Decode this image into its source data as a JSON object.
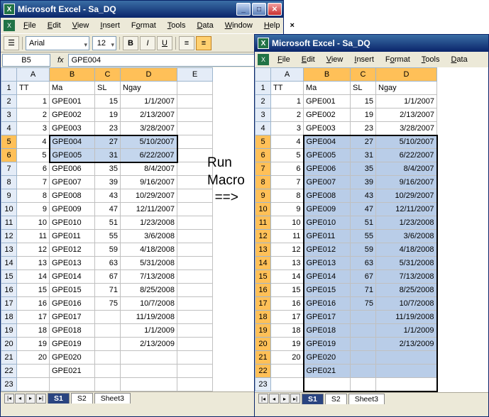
{
  "app_title": "Microsoft Excel - Sa_DQ",
  "menu": [
    "File",
    "Edit",
    "View",
    "Insert",
    "Format",
    "Tools",
    "Data",
    "Window",
    "Help"
  ],
  "menu_short": [
    "File",
    "Edit",
    "View",
    "Insert",
    "Format",
    "Tools",
    "Data"
  ],
  "toolbar": {
    "font": "Arial",
    "size": "12",
    "bold": "B",
    "italic": "I",
    "underline": "U"
  },
  "namebox": "B5",
  "formula": "GPE004",
  "macro_label1": "Run",
  "macro_label2": "Macro",
  "macro_label3": "==>",
  "headers": {
    "A": "A",
    "B": "B",
    "C": "C",
    "D": "D",
    "E": "E"
  },
  "row1": {
    "A": "TT",
    "B": "Ma",
    "C": "SL",
    "D": "Ngay"
  },
  "rows": [
    {
      "n": "1",
      "A": "1",
      "B": "GPE001",
      "C": "15",
      "D": "1/1/2007"
    },
    {
      "n": "2",
      "A": "2",
      "B": "GPE002",
      "C": "19",
      "D": "2/13/2007"
    },
    {
      "n": "3",
      "A": "3",
      "B": "GPE003",
      "C": "23",
      "D": "3/28/2007"
    },
    {
      "n": "4",
      "A": "4",
      "B": "GPE004",
      "C": "27",
      "D": "5/10/2007"
    },
    {
      "n": "5",
      "A": "5",
      "B": "GPE005",
      "C": "31",
      "D": "6/22/2007"
    },
    {
      "n": "6",
      "A": "6",
      "B": "GPE006",
      "C": "35",
      "D": "8/4/2007"
    },
    {
      "n": "7",
      "A": "7",
      "B": "GPE007",
      "C": "39",
      "D": "9/16/2007"
    },
    {
      "n": "8",
      "A": "8",
      "B": "GPE008",
      "C": "43",
      "D": "10/29/2007"
    },
    {
      "n": "9",
      "A": "9",
      "B": "GPE009",
      "C": "47",
      "D": "12/11/2007"
    },
    {
      "n": "10",
      "A": "10",
      "B": "GPE010",
      "C": "51",
      "D": "1/23/2008"
    },
    {
      "n": "11",
      "A": "11",
      "B": "GPE011",
      "C": "55",
      "D": "3/6/2008"
    },
    {
      "n": "12",
      "A": "12",
      "B": "GPE012",
      "C": "59",
      "D": "4/18/2008"
    },
    {
      "n": "13",
      "A": "13",
      "B": "GPE013",
      "C": "63",
      "D": "5/31/2008"
    },
    {
      "n": "14",
      "A": "14",
      "B": "GPE014",
      "C": "67",
      "D": "7/13/2008"
    },
    {
      "n": "15",
      "A": "15",
      "B": "GPE015",
      "C": "71",
      "D": "8/25/2008"
    },
    {
      "n": "16",
      "A": "16",
      "B": "GPE016",
      "C": "75",
      "D": "10/7/2008"
    },
    {
      "n": "17",
      "A": "17",
      "B": "GPE017",
      "C": "",
      "D": "11/19/2008"
    },
    {
      "n": "18",
      "A": "18",
      "B": "GPE018",
      "C": "",
      "D": "1/1/2009"
    },
    {
      "n": "19",
      "A": "19",
      "B": "GPE019",
      "C": "",
      "D": "2/13/2009"
    },
    {
      "n": "20",
      "A": "20",
      "B": "GPE020",
      "C": "",
      "D": ""
    },
    {
      "n": "21",
      "A": "",
      "B": "GPE021",
      "C": "",
      "D": ""
    },
    {
      "n": "22",
      "A": "",
      "B": "",
      "C": "",
      "D": ""
    }
  ],
  "rows2": [
    {
      "n": "1",
      "A": "1",
      "B": "GPE001",
      "C": "15",
      "D": "1/1/2007"
    },
    {
      "n": "2",
      "A": "2",
      "B": "GPE002",
      "C": "19",
      "D": "2/13/2007"
    },
    {
      "n": "3",
      "A": "3",
      "B": "GPE003",
      "C": "23",
      "D": "3/28/2007"
    },
    {
      "n": "4",
      "A": "4",
      "B": "GPE004",
      "C": "27",
      "D": "5/10/2007"
    },
    {
      "n": "5",
      "A": "5",
      "B": "GPE005",
      "C": "31",
      "D": "6/22/2007"
    },
    {
      "n": "6",
      "A": "6",
      "B": "GPE006",
      "C": "35",
      "D": "8/4/2007"
    },
    {
      "n": "7",
      "A": "7",
      "B": "GPE007",
      "C": "39",
      "D": "9/16/2007"
    },
    {
      "n": "8",
      "A": "8",
      "B": "GPE008",
      "C": "43",
      "D": "10/29/2007"
    },
    {
      "n": "9",
      "A": "9",
      "B": "GPE009",
      "C": "47",
      "D": "12/11/2007"
    },
    {
      "n": "10",
      "A": "10",
      "B": "GPE010",
      "C": "51",
      "D": "1/23/2008"
    },
    {
      "n": "11",
      "A": "11",
      "B": "GPE011",
      "C": "55",
      "D": "3/6/2008"
    },
    {
      "n": "12",
      "A": "12",
      "B": "GPE012",
      "C": "59",
      "D": "4/18/2008"
    },
    {
      "n": "13",
      "A": "13",
      "B": "GPE013",
      "C": "63",
      "D": "5/31/2008"
    },
    {
      "n": "14",
      "A": "14",
      "B": "GPE014",
      "C": "67",
      "D": "7/13/2008"
    },
    {
      "n": "15",
      "A": "15",
      "B": "GPE015",
      "C": "71",
      "D": "8/25/2008"
    },
    {
      "n": "16",
      "A": "16",
      "B": "GPE016",
      "C": "75",
      "D": "10/7/2008"
    },
    {
      "n": "17",
      "A": "17",
      "B": "GPE017",
      "C": "",
      "D": "11/19/2008"
    },
    {
      "n": "18",
      "A": "18",
      "B": "GPE018",
      "C": "",
      "D": "1/1/2009"
    },
    {
      "n": "19",
      "A": "19",
      "B": "GPE019",
      "C": "",
      "D": "2/13/2009"
    },
    {
      "n": "20",
      "A": "20",
      "B": "GPE020",
      "C": "",
      "D": ""
    },
    {
      "n": "21",
      "A": "",
      "B": "GPE021",
      "C": "",
      "D": ""
    },
    {
      "n": "22",
      "A": "",
      "B": "",
      "C": "",
      "D": ""
    }
  ],
  "tabs": [
    "S1",
    "S2",
    "Sheet3"
  ],
  "colw1": {
    "A": 46,
    "B": 64,
    "C": 36,
    "D": 80,
    "E": 50
  },
  "colw2": {
    "A": 46,
    "B": 66,
    "C": 36,
    "D": 86
  },
  "sel1": {
    "start": 4,
    "end": 5
  },
  "sel2": {
    "start": 4,
    "end": 21
  }
}
